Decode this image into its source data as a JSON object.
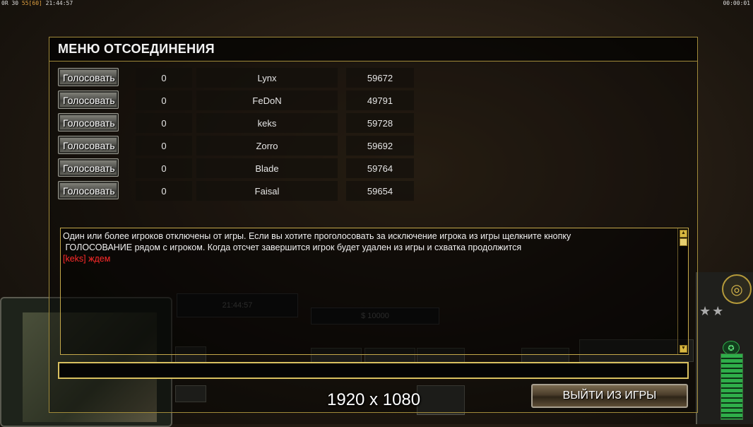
{
  "hud": {
    "left_prefix": "0R 30",
    "left_fps": "55[60]",
    "left_time": "21:44:57",
    "right_time": "00:00:01"
  },
  "background": {
    "timer": "21:44:57",
    "money": "$ 10000",
    "stars": "★★"
  },
  "dialog": {
    "title": "МЕНЮ ОТСОЕДИНЕНИЯ",
    "vote_label": "Голосовать",
    "players": [
      {
        "votes": "0",
        "name": "Lynx",
        "id": "59672"
      },
      {
        "votes": "0",
        "name": "FeDoN",
        "id": "49791"
      },
      {
        "votes": "0",
        "name": "keks",
        "id": "59728"
      },
      {
        "votes": "0",
        "name": "Zorro",
        "id": "59692"
      },
      {
        "votes": "0",
        "name": "Blade",
        "id": "59764"
      },
      {
        "votes": "0",
        "name": "Faisal",
        "id": "59654"
      }
    ],
    "messages": {
      "line1": "Один или более игроков отключены от игры. Если вы хотите проголосовать за исключение игрока из игры щелкните кнопку",
      "line2": " ГОЛОСОВАНИЕ рядом с игроком. Когда отсчет завершится игрок будет удален из игры и схватка продолжится",
      "line3": "[keks] ждем"
    },
    "chat_value": "",
    "exit_label": "ВЫЙТИ ИЗ ИГРЫ"
  },
  "overlay": {
    "resolution": "1920 x 1080"
  },
  "colors": {
    "accent_gold": "#c4a84a",
    "alert_red": "#ff2a2a"
  }
}
